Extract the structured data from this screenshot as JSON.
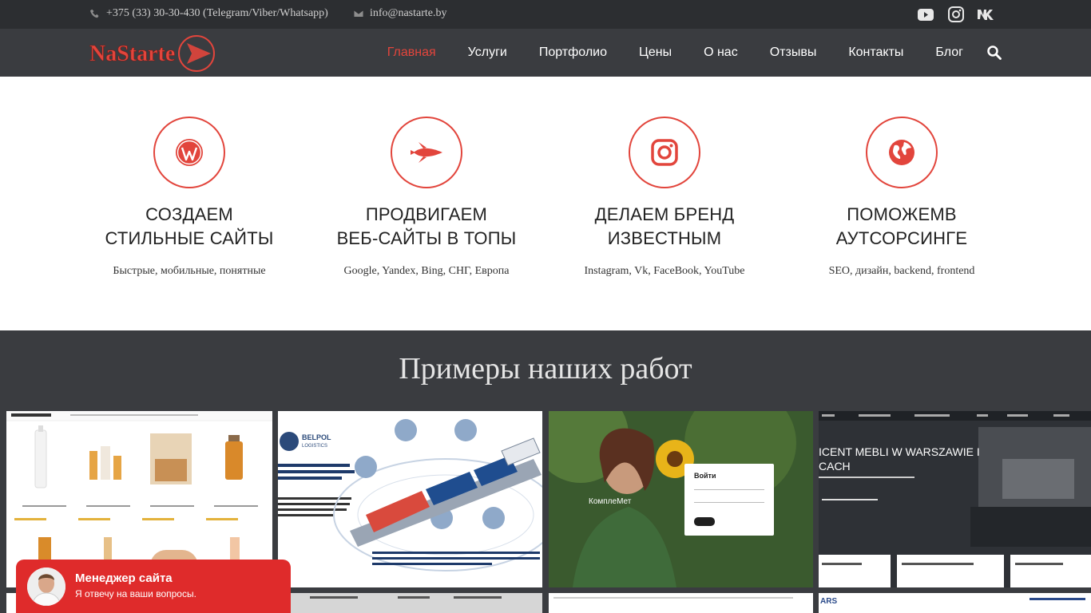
{
  "topbar": {
    "phone": "+375 (33) 30-30-430 (Telegram/Viber/Whatsapp)",
    "email": "info@nastarte.by",
    "social_icons": [
      "youtube-icon",
      "instagram-icon",
      "vk-icon"
    ]
  },
  "brand": {
    "logo_text": "NaStarte",
    "accent": "#e2453c"
  },
  "nav": {
    "items": [
      {
        "label": "Главная",
        "active": true
      },
      {
        "label": "Услуги"
      },
      {
        "label": "Портфолио"
      },
      {
        "label": "Цены"
      },
      {
        "label": "О нас"
      },
      {
        "label": "Отзывы"
      },
      {
        "label": "Контакты"
      },
      {
        "label": "Блог"
      }
    ]
  },
  "features": [
    {
      "icon": "wordpress-icon",
      "line1": "СОЗДАЕМ",
      "line2": "СТИЛЬНЫЕ САЙТЫ",
      "sub": "Быстрые, мобильные, понятные"
    },
    {
      "icon": "rocket-icon",
      "line1": "ПРОДВИГАЕМ",
      "line2": "ВЕБ-САЙТЫ В ТОПЫ",
      "sub": "Google, Yandex, Bing, СНГ, Европа"
    },
    {
      "icon": "instagram-icon",
      "line1": "ДЕЛАЕМ БРЕНД",
      "line2": "ИЗВЕСТНЫМ",
      "sub": "Instagram, Vk, FaceBook, YouTube"
    },
    {
      "icon": "globe-icon",
      "line1": "ПОМОЖЕМВ",
      "line2": "АУТСОРСИНГЕ",
      "sub": "SEO, дизайн, backend, frontend"
    }
  ],
  "works": {
    "title": "Примеры наших работ",
    "tiles": [
      {
        "name": "portfolio-cosmetics-shop"
      },
      {
        "name": "portfolio-belpol-logistics",
        "logo": "BELPOL LOGISTICS",
        "caption": "Наша инфографика наглядно показывает весь процесс транспортировки вашего груза, начиная с подачи заявки и заканчивая его доставкой до пункта назначения."
      },
      {
        "name": "portfolio-komplemet",
        "login_title": "Войти",
        "brand": "КомплеМет"
      },
      {
        "name": "portfolio-furniture-warsaw",
        "headline": "ICENT MEBLI W WARSZAWIE I CACH"
      }
    ]
  },
  "chat": {
    "title": "Менеджер сайта",
    "subtitle": "Я отвечу на ваши вопросы."
  }
}
